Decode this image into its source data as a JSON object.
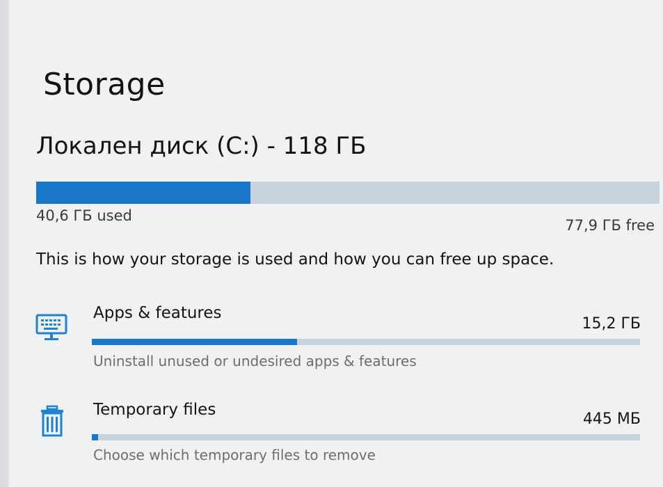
{
  "page": {
    "title": "Storage",
    "drive_name": "Локален диск (C:) - 118 ГБ",
    "drive_used_label": "40,6 ГБ used",
    "drive_free_label": "77,9 ГБ free",
    "drive_used_fraction": 0.344,
    "description": "This is how your storage is used and how you can free up space."
  },
  "categories": [
    {
      "name": "Apps & features",
      "size": "15,2 ГБ",
      "subtitle": "Uninstall unused or undesired apps & features",
      "icon": "keyboard-monitor-icon",
      "fraction": 0.374
    },
    {
      "name": "Temporary files",
      "size": "445 МБ",
      "subtitle": "Choose which temporary files to remove",
      "icon": "trash-icon",
      "fraction": 0.011
    }
  ],
  "colors": {
    "accent": "#1976c9",
    "bar_track": "#c7d2df",
    "icon_accent": "#1e83d4"
  }
}
